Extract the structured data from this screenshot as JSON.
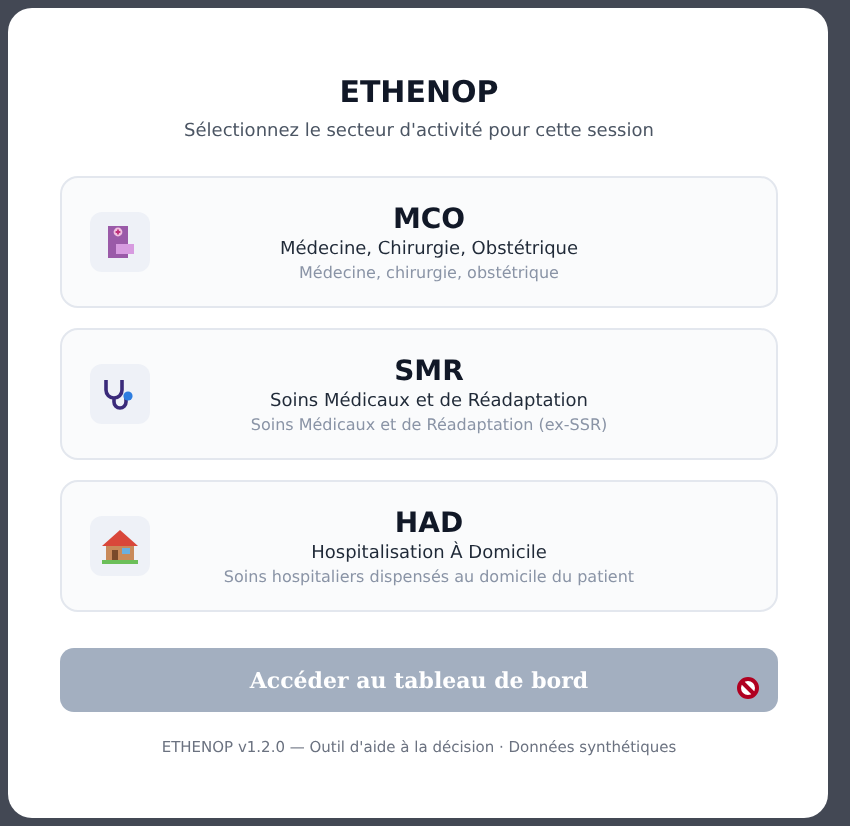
{
  "title": "ETHENOP",
  "subtitle": "Sélectionnez le secteur d'activité pour cette session",
  "sectors": [
    {
      "code": "MCO",
      "name": "Médecine, Chirurgie, Obstétrique",
      "description": "Médecine, chirurgie, obstétrique",
      "selected": false
    },
    {
      "code": "SMR",
      "name": "Soins Médicaux et de Réadaptation",
      "description": "Soins Médicaux et de Réadaptation (ex-SSR)",
      "selected": false
    },
    {
      "code": "HAD",
      "name": "Hospitalisation À Domicile",
      "description": "Soins hospitaliers dispensés au domicile du patient",
      "selected": false
    }
  ],
  "submit": {
    "label": "Accéder au tableau de bord",
    "disabled": true
  },
  "footer": "ETHENOP v1.2.0 — Outil d'aide à la décision · Données synthétiques"
}
